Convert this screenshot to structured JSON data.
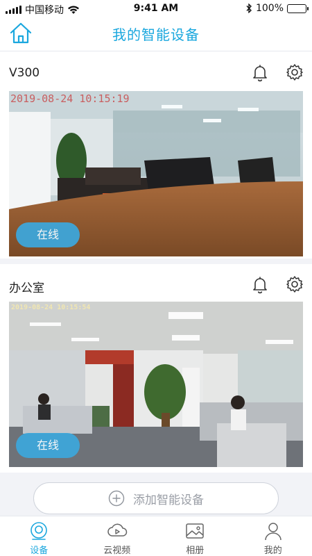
{
  "status_bar": {
    "carrier": "中国移动",
    "time": "9:41 AM",
    "battery": "100%"
  },
  "header": {
    "title": "我的智能设备"
  },
  "devices": [
    {
      "name": "V300",
      "timestamp": "2019-08-24 10:15:19",
      "status": "在线"
    },
    {
      "name": "办公室",
      "timestamp": "2019-08-24 10:15:54",
      "status": "在线"
    }
  ],
  "add_device": {
    "label": "添加智能设备"
  },
  "tabs": [
    {
      "label": "设备",
      "icon": "device-icon",
      "active": true
    },
    {
      "label": "云视频",
      "icon": "cloud-video-icon",
      "active": false
    },
    {
      "label": "相册",
      "icon": "album-icon",
      "active": false
    },
    {
      "label": "我的",
      "icon": "profile-icon",
      "active": false
    }
  ],
  "colors": {
    "accent": "#1aa7de",
    "status_button": "#3ea6d9",
    "background": "#f2f3f7"
  }
}
